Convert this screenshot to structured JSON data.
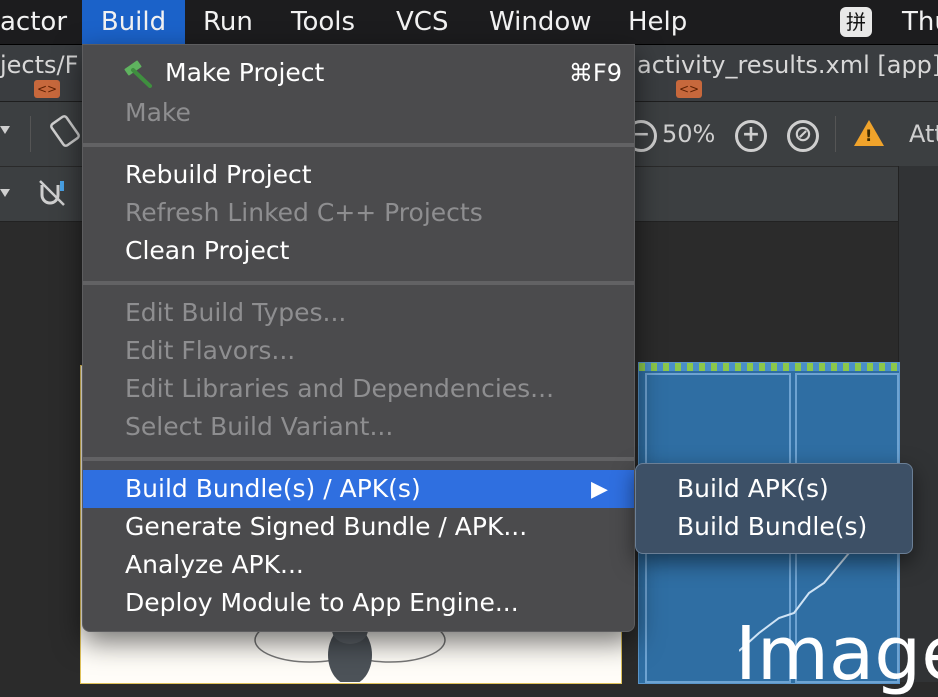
{
  "menubar": {
    "items": [
      "actor",
      "Build",
      "Run",
      "Tools",
      "VCS",
      "Window",
      "Help"
    ],
    "ime_label": "拼",
    "clock_partial": "Thu"
  },
  "ide": {
    "tab_left": "jects/F",
    "tab_right": "activity_results.xml [app]",
    "zoom": "50%",
    "attributes_partial": "Att",
    "blueprint_text": "Image"
  },
  "build_menu": {
    "make_project": "Make Project",
    "make_project_shortcut": "⌘F9",
    "make": "Make",
    "rebuild_project": "Rebuild Project",
    "refresh_linked_cpp": "Refresh Linked C++ Projects",
    "clean_project": "Clean Project",
    "edit_build_types": "Edit Build Types...",
    "edit_flavors": "Edit Flavors...",
    "edit_libraries": "Edit Libraries and Dependencies...",
    "select_build_variant": "Select Build Variant...",
    "build_bundles_apks": "Build Bundle(s) / APK(s)",
    "generate_signed": "Generate Signed Bundle / APK...",
    "analyze_apk": "Analyze APK...",
    "deploy_module": "Deploy Module to App Engine..."
  },
  "submenu": {
    "build_apks": "Build APK(s)",
    "build_bundles": "Build Bundle(s)"
  },
  "colors": {
    "menu_bg": "#4b4b4d",
    "highlight": "#2f6fe0",
    "menubar_active": "#1b62c9",
    "warning": "#f0a32b"
  }
}
